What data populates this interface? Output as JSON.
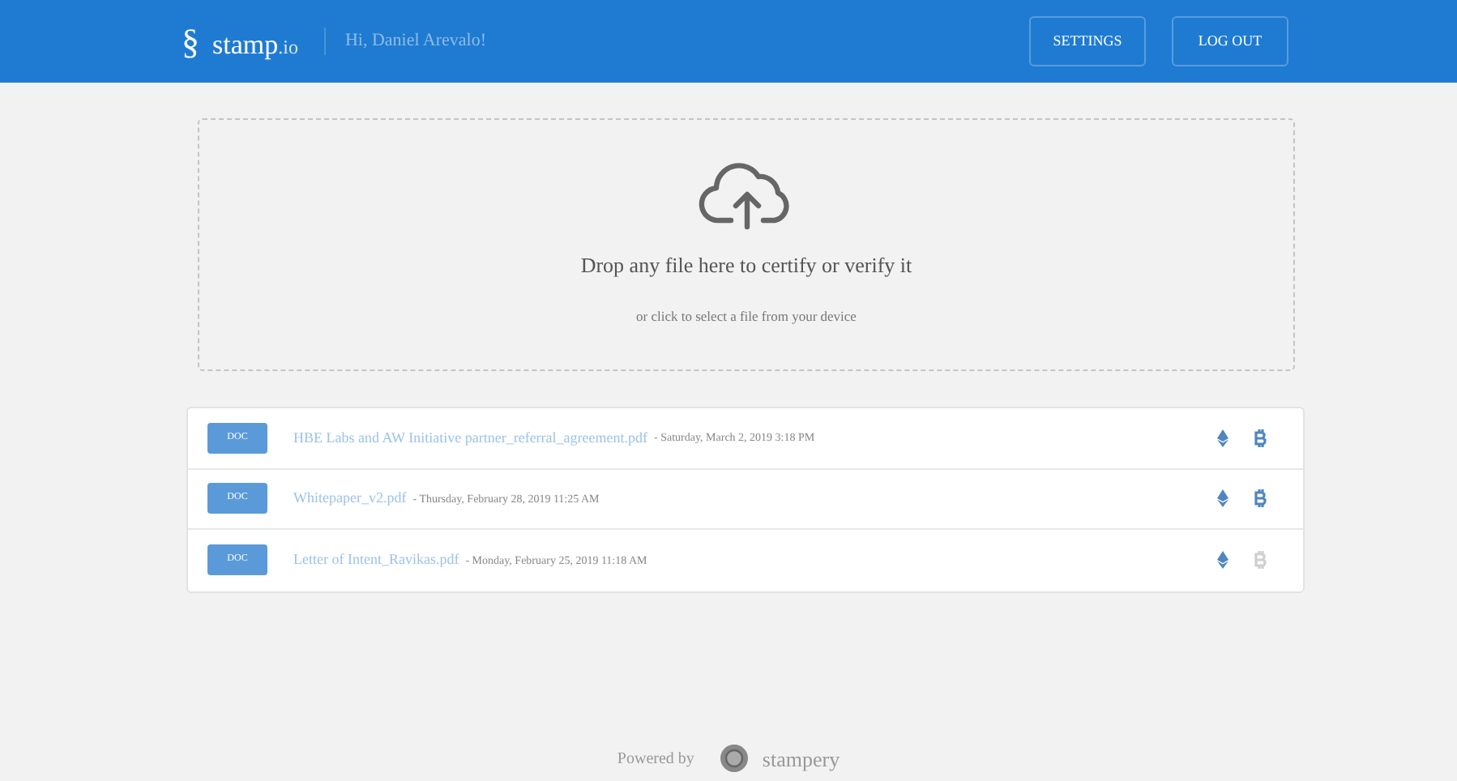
{
  "header": {
    "logo_mark": "§",
    "logo_name": "stamp",
    "logo_suffix": ".io",
    "greeting": "Hi, Daniel Arevalo!",
    "buttons": [
      "SETTINGS",
      "LOG OUT"
    ]
  },
  "dropzone": {
    "title": "Drop any file here to certify or verify it",
    "subtitle": "or click to select a file from your device"
  },
  "files": [
    {
      "type": "DOC",
      "name": "HBE Labs and AW Initiative partner_referral_agreement.pdf",
      "date": "- Saturday, March 2, 2019 3:18 PM",
      "ethereum": true,
      "bitcoin": true
    },
    {
      "type": "DOC",
      "name": "Whitepaper_v2.pdf",
      "date": "- Thursday, February 28, 2019 11:25 AM",
      "ethereum": true,
      "bitcoin": true
    },
    {
      "type": "DOC",
      "name": "Letter of Intent_Ravikas.pdf",
      "date": "- Monday, February 25, 2019 11:18 AM",
      "ethereum": true,
      "bitcoin": false
    }
  ],
  "footer": {
    "powered": "Powered by",
    "brand": "stampery"
  }
}
